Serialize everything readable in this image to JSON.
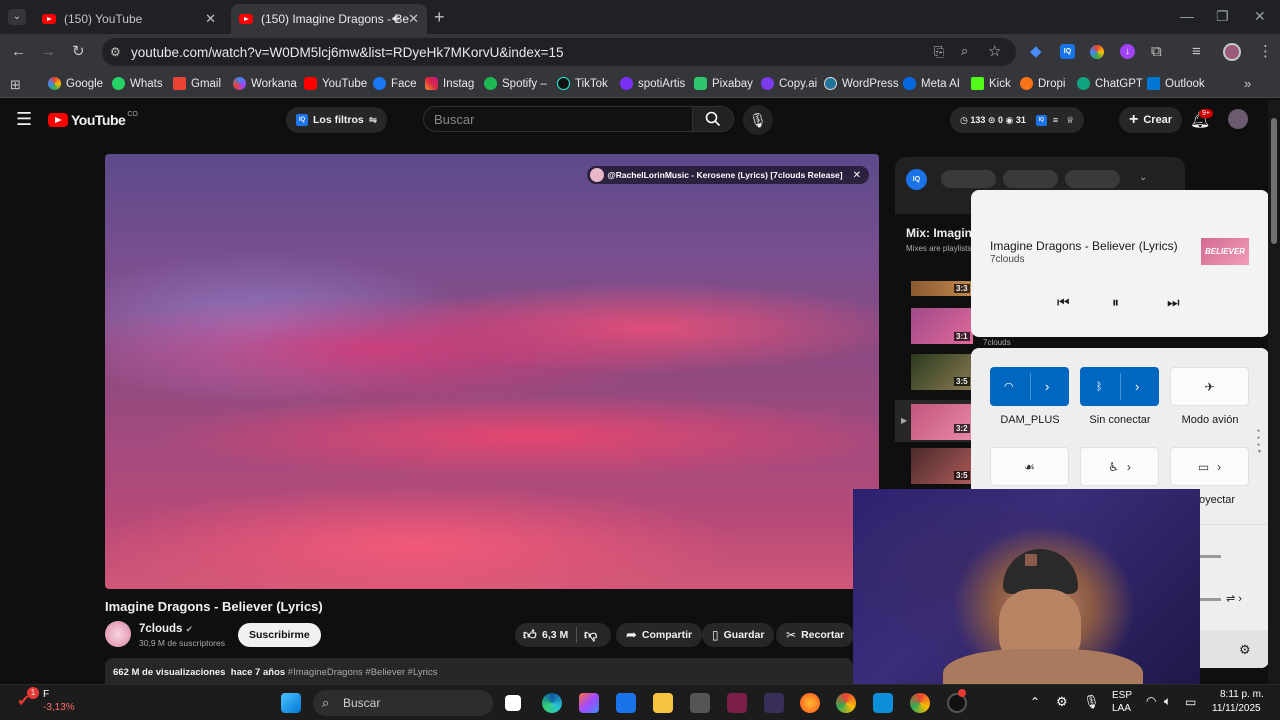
{
  "browser": {
    "tabs": [
      {
        "title": "(150) YouTube",
        "active": false
      },
      {
        "title": "(150) Imagine Dragons - Be",
        "active": true
      }
    ],
    "url": "youtube.com/watch?v=W0DM5lcj6mw&list=RDyeHk7MKorvU&index=15",
    "bookmarks": [
      "Google",
      "Whats",
      "Gmail",
      "Workana",
      "YouTube",
      "Face",
      "Instag",
      "Spotify –",
      "TikTok",
      "spotiArtis",
      "Pixabay",
      "Copy.ai",
      "WordPress",
      "Meta AI",
      "Kick",
      "Dropi",
      "ChatGPT",
      "Outlook"
    ]
  },
  "youtube": {
    "logo_text": "YouTube",
    "country": "CO",
    "filters_label": "Los filtros",
    "search_placeholder": "Buscar",
    "stats": {
      "a": "133",
      "b": "0",
      "c": "31"
    },
    "create_label": "Crear",
    "notif_badge": "9+",
    "video_overlay_title": "@RachelLorinMusic - Kerosene (Lyrics) [7clouds Release]",
    "video_title": "Imagine Dragons - Believer (Lyrics)",
    "channel": "7clouds",
    "subscribers": "30,9 M de suscriptores",
    "subscribe_label": "Suscribirme",
    "likes": "6,3 M",
    "share_label": "Compartir",
    "save_label": "Guardar",
    "clip_label": "Recortar",
    "views": "662 M de visualizaciones",
    "age": "hace 7 años",
    "tags": "#ImagineDragons #Believer #Lyrics",
    "mix_title": "Mix: Imagin",
    "mix_sub": "Mixes are playlists",
    "playlist_durations": [
      "3:3",
      "3:1",
      "3:5",
      "3:2",
      "3:5"
    ],
    "playlist_channel": "7clouds"
  },
  "media_flyout": {
    "title": "Imagine Dragons - Believer (Lyrics)",
    "artist": "7clouds",
    "thumb_text": "BELIEVER"
  },
  "quick_settings": {
    "wifi_label": "DAM_PLUS",
    "bluetooth_label": "Sin conectar",
    "airplane_label": "Modo avión",
    "project_label": "oyectar"
  },
  "taskbar": {
    "stock_name": "F",
    "stock_change": "-3,13%",
    "stock_badge": "1",
    "search_placeholder": "Buscar",
    "lang": "ESP",
    "lang2": "LAA",
    "time": "8:11 p. m.",
    "date": "11/11/2025"
  }
}
